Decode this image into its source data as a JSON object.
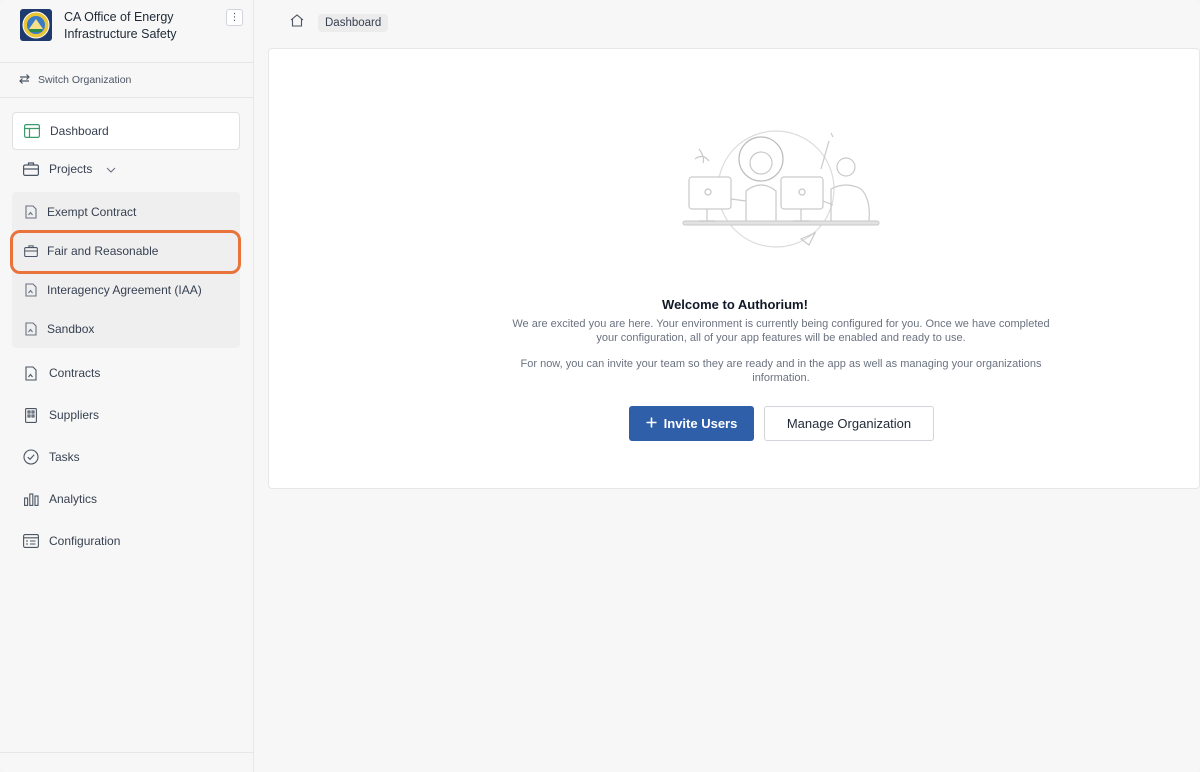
{
  "org": {
    "name": "CA Office of Energy Infrastructure Safety",
    "menu_glyph": "⋮"
  },
  "switch_org": {
    "label": "Switch Organization"
  },
  "nav": {
    "dashboard": "Dashboard",
    "projects": "Projects",
    "project_items": [
      "Exempt Contract",
      "Fair and Reasonable",
      "Interagency Agreement (IAA)",
      "Sandbox"
    ],
    "contracts": "Contracts",
    "suppliers": "Suppliers",
    "tasks": "Tasks",
    "analytics": "Analytics",
    "configuration": "Configuration"
  },
  "breadcrumb": {
    "current": "Dashboard"
  },
  "welcome": {
    "title": "Welcome to Authorium!",
    "text1": "We are excited you are here. Your environment is currently being configured for you. Once we have completed your configuration, all of your app features will be enabled and ready to use.",
    "text2": "For now, you can invite your team so they are ready and in the app as well as managing your organizations information."
  },
  "buttons": {
    "invite": "Invite Users",
    "manage": "Manage Organization"
  },
  "colors": {
    "primary": "#2f5fa8",
    "highlight": "#e8743b"
  }
}
